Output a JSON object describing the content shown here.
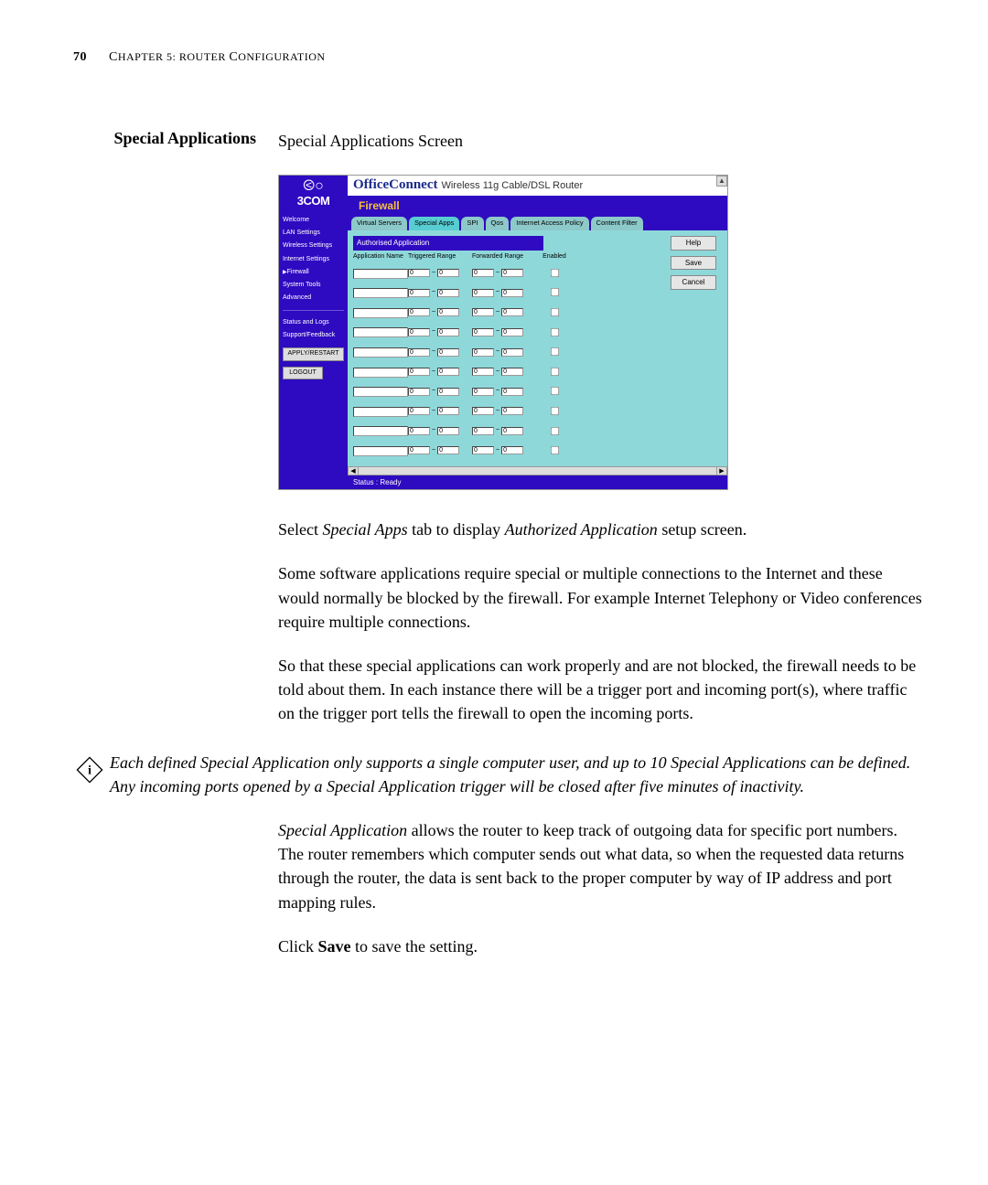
{
  "page_number": "70",
  "chapter_label_prefix": "C",
  "chapter_label_rest": "HAPTER 5: R",
  "chapter_label_rest2": "OUTER ",
  "chapter_label_rest3": "C",
  "chapter_label_rest4": "ONFIGURATION",
  "section_title": "Special Applications",
  "subtitle": "Special Applications Screen",
  "screenshot": {
    "logo_text": "3COM",
    "banner_brand": "OfficeConnect",
    "banner_tag": " Wireless 11g Cable/DSL Router",
    "firewall_label": "Firewall",
    "tabs": [
      "Virtual Servers",
      "Special Apps",
      "SPI",
      "Qos",
      "Internet Access Policy",
      "Content Filter"
    ],
    "sidebar": {
      "items": [
        "Welcome",
        "LAN Settings",
        "Wireless Settings",
        "Internet Settings",
        "Firewall",
        "System Tools",
        "Advanced"
      ],
      "lower_items": [
        "Status and Logs",
        "Support/Feedback"
      ],
      "apply_btn": "APPLY/RESTART",
      "logout_btn": "LOGOUT"
    },
    "panel_title": "Authorised Application",
    "columns": {
      "name": "Application Name",
      "triggered": "Triggered Range",
      "forwarded": "Forwarded Range",
      "enabled": "Enabled"
    },
    "row_value": "0",
    "buttons": {
      "help": "Help",
      "save": "Save",
      "cancel": "Cancel"
    },
    "status": "Status : Ready"
  },
  "para1_a": "Select ",
  "para1_b": "Special Apps",
  "para1_c": " tab to display ",
  "para1_d": "Authorized Application",
  "para1_e": " setup screen.",
  "para2": "Some software applications require special or multiple connections to the Internet and these would normally be blocked by the firewall. For example Internet Telephony or Video conferences require multiple connections.",
  "para3": "So that these special applications can work properly and are not blocked, the firewall needs to be told about them. In each instance there will be a trigger port and incoming port(s), where traffic on the trigger port tells the firewall to open the incoming ports.",
  "note": "Each defined Special Application only supports a single computer user, and up to 10 Special Applications can be defined. Any incoming ports opened by a Special Application trigger will be closed after five minutes of inactivity.",
  "para4_a": "Special Application",
  "para4_b": " allows the router to keep track of outgoing data for specific port numbers. The router remembers which computer sends out what data, so when the requested data returns through the router, the data is sent back to the proper computer by way of IP address and port mapping rules.",
  "para5_a": "Click ",
  "para5_b": "Save",
  "para5_c": " to save the setting."
}
